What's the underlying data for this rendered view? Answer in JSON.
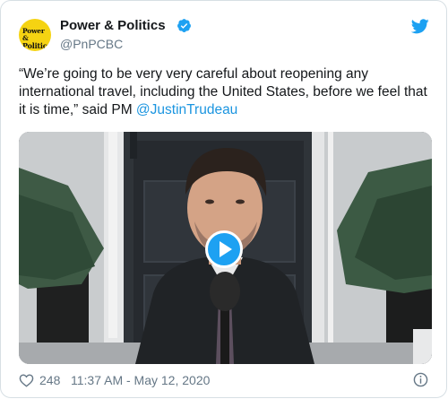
{
  "account": {
    "avatar_text_1": "Power &",
    "avatar_text_2": "Politics",
    "display_name": "Power & Politics",
    "handle": "@PnPCBC",
    "verified": true
  },
  "tweet": {
    "text_before": "“We’re going to be very very careful about reopening any international travel, including the United States, before we feel that it is time,” said PM ",
    "mention": "@JustinTrudeau"
  },
  "media": {
    "type": "video",
    "play_icon": "play-icon"
  },
  "footer": {
    "likes": "248",
    "timestamp": "11:37 AM - May 12, 2020"
  },
  "colors": {
    "brand_blue": "#1da1f2",
    "link_blue": "#1b95e0",
    "avatar_yellow": "#f5d312",
    "muted_text": "#657786"
  }
}
